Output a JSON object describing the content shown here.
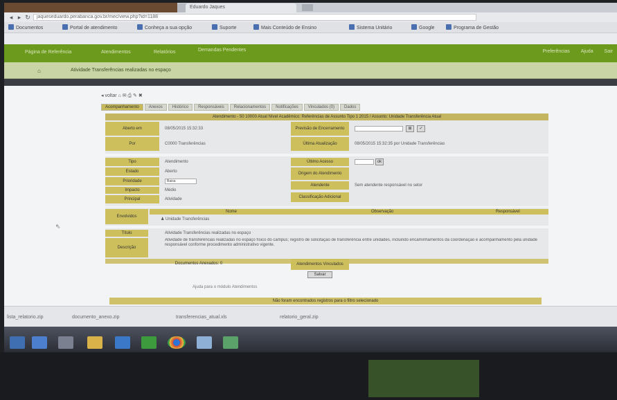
{
  "browser": {
    "tabs": [
      {
        "label": "Eduardo Jaques"
      },
      {
        "label": ""
      }
    ],
    "url": "jaqueseduardo.perabanca.gov.br/mec/view.php?id=1188",
    "bookmarks": [
      {
        "label": "Documentos"
      },
      {
        "label": "Portal de atendimento"
      },
      {
        "label": "Conheça a sua opção"
      },
      {
        "label": "Suporte"
      },
      {
        "label": "Mais Conteúdo de Ensino"
      },
      {
        "label": "Sistema Unitário"
      },
      {
        "label": "Google"
      },
      {
        "label": "Programa de Gestão"
      }
    ]
  },
  "site_nav": {
    "items": [
      "Página de Referência",
      "Atendimentos",
      "Relatórios",
      "Demandas Pendentes"
    ],
    "right": [
      "Preferências",
      "Ajuda",
      "Sair"
    ]
  },
  "breadcrumb": {
    "home": "⌂",
    "text": "Atividade Transferências realizadas no espaço"
  },
  "toolbar_mini": "◂ voltar  ⌂  ✉  ⎙  ✎  ✖",
  "subtabs": [
    "Acompanhamento",
    "Anexos",
    "Histórico",
    "Responsáveis",
    "Relacionamentos",
    "Notificações",
    "Vinculados (0)",
    "Dados"
  ],
  "form": {
    "title": "Atendimento - 50 10000 Atual Nível Acadêmico: Referências de Assunto Tipo 1 2015 / Assunto: Unidade Transferência Atual",
    "aberto_em": {
      "label": "Aberto em",
      "value": "08/05/2015 15:32:33"
    },
    "previsao": {
      "label": "Previsão de Encerramento",
      "value": "",
      "btn1": "⊞",
      "btn2": "✓"
    },
    "por": {
      "label": "Por",
      "value": "C0000 Transferências"
    },
    "ultima": {
      "label": "Última Atualização",
      "value": "08/05/2015 15:32:35 por Unidade Transferências"
    },
    "tipo": {
      "label": "Tipo",
      "value": "Atendimento"
    },
    "ultimo_acesso": {
      "label": "Último Acesso",
      "value": "",
      "btn": "ok"
    },
    "estado": {
      "label": "Estado",
      "value": "Aberto"
    },
    "origem": {
      "label": "Origem do Atendimento",
      "value": ""
    },
    "prioridade": {
      "label": "Prioridade",
      "value": "Baixa"
    },
    "atendente": {
      "label": "Atendente",
      "value": "Sem atendente responsável no setor"
    },
    "impacto": {
      "label": "Impacto",
      "value": "Médio"
    },
    "principal": {
      "label": "Principal",
      "value": "Atividade"
    },
    "classificacao": {
      "label": "Classificação Adicional",
      "value": ""
    },
    "envolvidos": {
      "label": "Envolvidos",
      "col_nome": "Nome",
      "col_obs": "Observação",
      "col_resp": "Responsável",
      "row": "Unidade Transferências"
    },
    "titulo": {
      "label": "Título",
      "value": "Atividade Transferências realizadas no espaço"
    },
    "descricao": {
      "label": "Descrição",
      "value": "Atividade de transferências realizadas no espaço físico do campus; registro de solicitação de transferência entre unidades, incluindo encaminhamentos da coordenação e acompanhamento pela unidade responsável conforme procedimento administrativo vigente."
    },
    "documentos": {
      "label": "Documentos Anexados: 0"
    },
    "vinculados": {
      "label": "Atendimentos Vinculados"
    },
    "submit": "Salvar"
  },
  "footer_link": "Ajuda para o módulo Atendimentos",
  "footer_bar": "Não foram encontrados registros para o filtro selecionado",
  "downloads": [
    {
      "label": "lista_relatorio.zip"
    },
    {
      "label": "documento_anexo.zip"
    },
    {
      "label": "transferencias_atual.xls"
    },
    {
      "label": "relatorio_geral.zip"
    }
  ],
  "colors": {
    "site_green": "#6b9a1c",
    "label_gold": "#cdbf5c",
    "title_gold": "#c4b661"
  }
}
